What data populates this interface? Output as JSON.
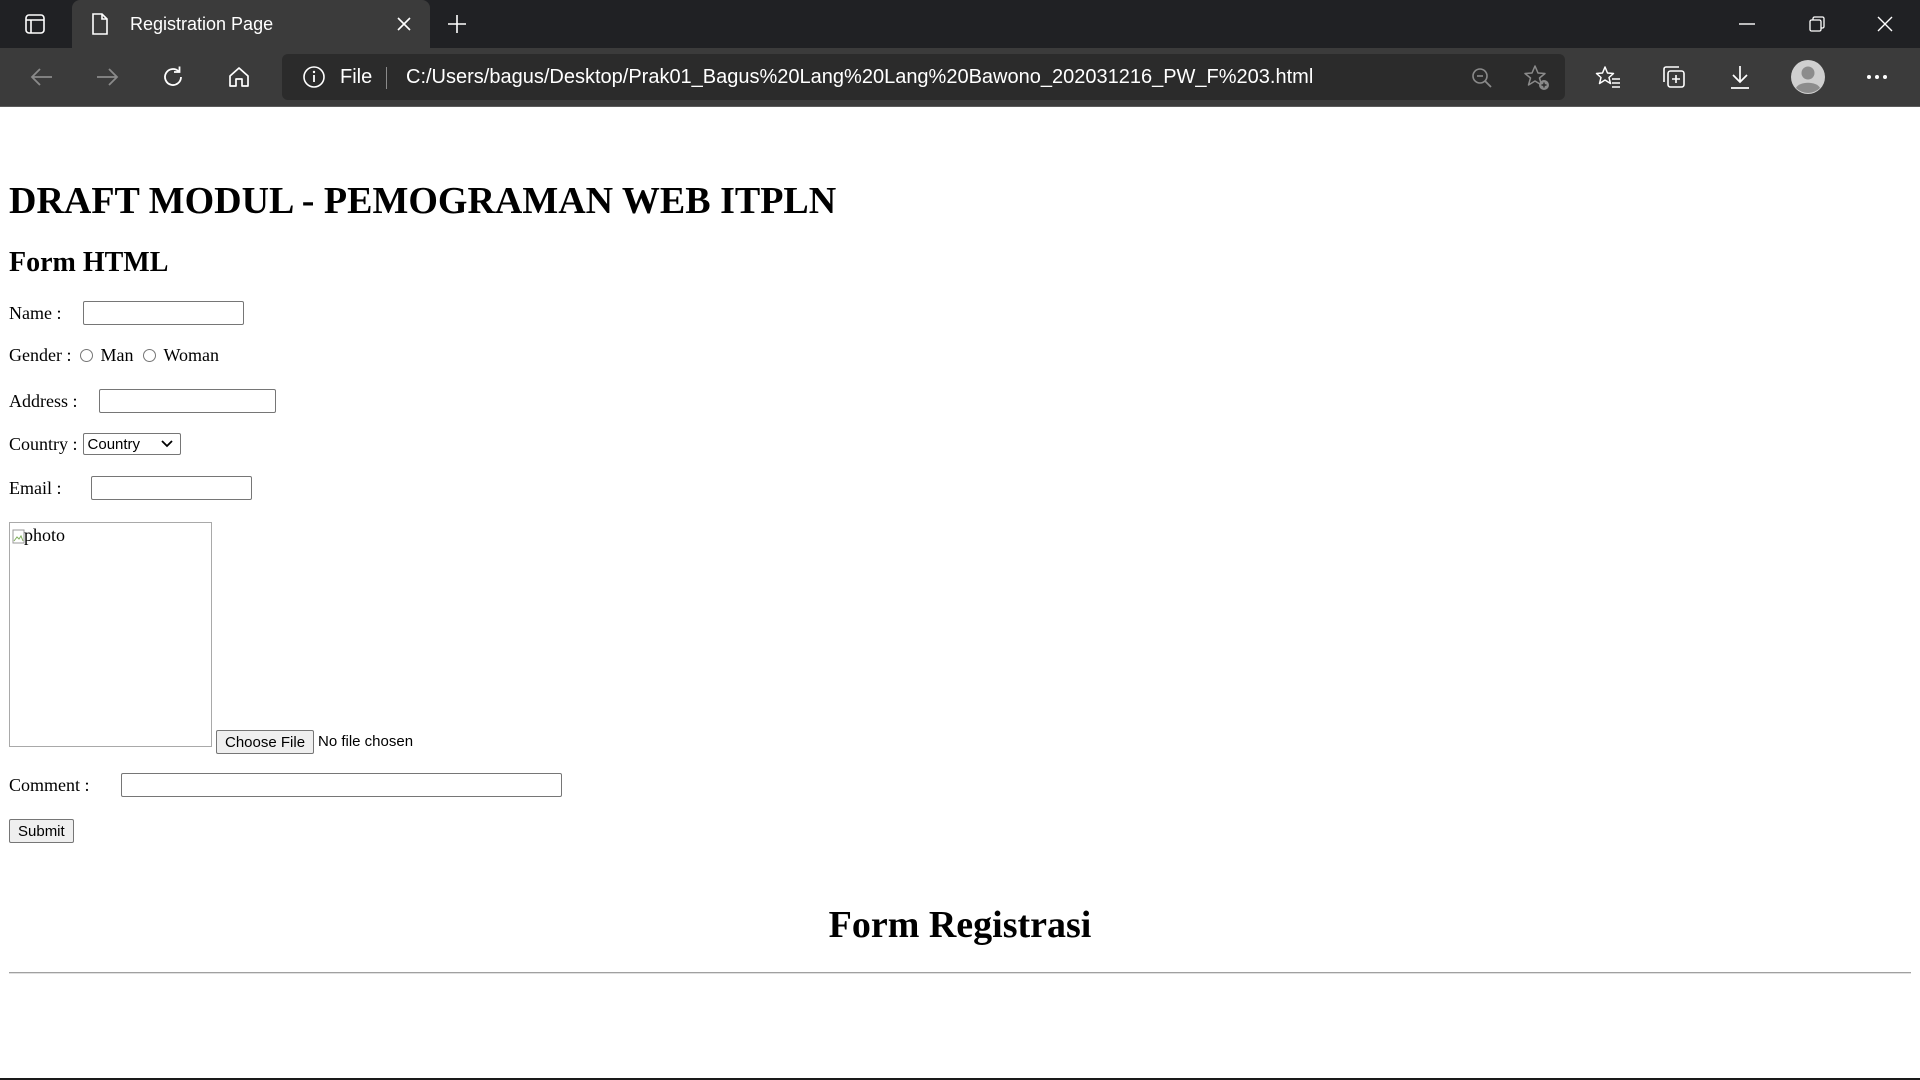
{
  "browser": {
    "tab_title": "Registration Page",
    "address_scheme": "File",
    "address_url": "C:/Users/bagus/Desktop/Prak01_Bagus%20Lang%20Lang%20Bawono_202031216_PW_F%203.html",
    "colors": {
      "titlebar": "#202124",
      "toolbar": "#3b3b3b",
      "addressbar": "#2b2b2b",
      "icon": "#ffffff"
    }
  },
  "page": {
    "heading": "DRAFT MODUL - PEMOGRAMAN WEB ITPLN",
    "subheading": "Form HTML",
    "form": {
      "name_label": "Name :",
      "name_value": "",
      "gender_label": "Gender :",
      "gender_options": [
        "Man",
        "Woman"
      ],
      "address_label": "Address :",
      "address_value": "",
      "country_label": "Country :",
      "country_selected": "Country",
      "email_label": "Email :",
      "email_value": "",
      "photo_alt": "photo",
      "file_button": "Choose File",
      "file_status": "No file chosen",
      "comment_label": "Comment :",
      "comment_value": "",
      "submit_label": "Submit"
    },
    "footer_heading": "Form Registrasi"
  }
}
